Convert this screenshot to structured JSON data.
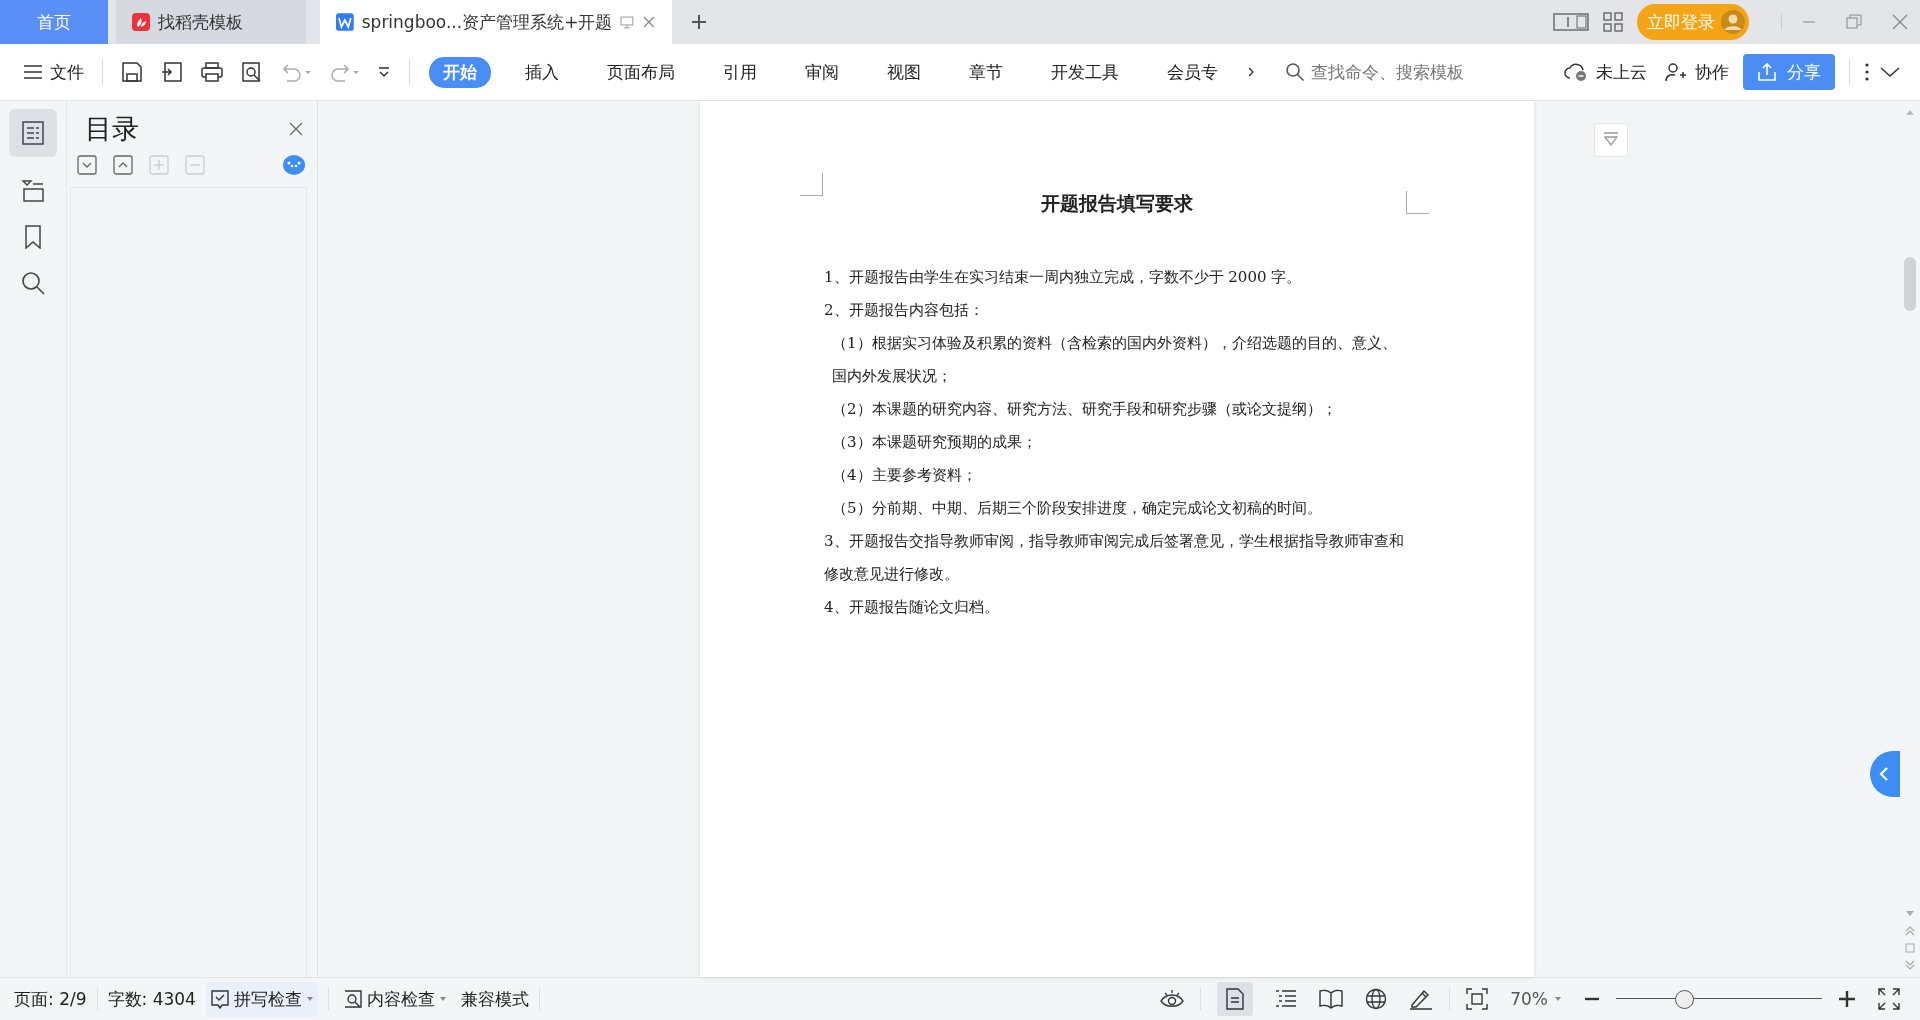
{
  "tabs": [
    {
      "kind": "home",
      "label": "首页",
      "selected": false
    },
    {
      "kind": "template",
      "label": "找稻壳模板",
      "selected": false
    },
    {
      "kind": "doc",
      "label": "springboo...资产管理系统+开题",
      "selected": true
    }
  ],
  "login_button": "立即登录",
  "toolbar": {
    "file_menu": "文件",
    "ribbon_tabs": [
      {
        "label": "开始",
        "selected": true
      },
      {
        "label": "插入",
        "selected": false
      },
      {
        "label": "页面布局",
        "selected": false
      },
      {
        "label": "引用",
        "selected": false
      },
      {
        "label": "审阅",
        "selected": false
      },
      {
        "label": "视图",
        "selected": false
      },
      {
        "label": "章节",
        "selected": false
      },
      {
        "label": "开发工具",
        "selected": false
      },
      {
        "label": "会员专",
        "selected": false
      }
    ],
    "search": {
      "placeholder": "查找命令、搜索模板"
    },
    "cloud_status": "未上云",
    "collab": "协作",
    "share": "分享"
  },
  "outline_panel": {
    "title": "目录"
  },
  "document": {
    "title": "开题报告填写要求",
    "paragraphs": [
      {
        "kind": "item",
        "text": "1、开题报告由学生在实习结束一周内独立完成，字数不少于 2000 字。"
      },
      {
        "kind": "item",
        "text": "2、开题报告内容包括："
      },
      {
        "kind": "sub",
        "text": "（1）根据实习体验及积累的资料（含检索的国内外资料），介绍选题的目的、意义、国内外发展状况；"
      },
      {
        "kind": "sub",
        "text": "（2）本课题的研究内容、研究方法、研究手段和研究步骤（或论文提纲）；"
      },
      {
        "kind": "sub",
        "text": "（3）本课题研究预期的成果；"
      },
      {
        "kind": "sub",
        "text": "（4）主要参考资料；"
      },
      {
        "kind": "sub",
        "text": "（5）分前期、中期、后期三个阶段安排进度，确定完成论文初稿的时间。"
      },
      {
        "kind": "item",
        "text": "3、开题报告交指导教师审阅，指导教师审阅完成后签署意见，学生根据指导教师审查和修改意见进行修改。"
      },
      {
        "kind": "item",
        "text": "4、开题报告随论文归档。"
      }
    ]
  },
  "status_bar": {
    "page": "页面: 2/9",
    "word_count": "字数: 4304",
    "spell_check": "拼写检查",
    "content_check": "内容检查",
    "mode": "兼容模式",
    "zoom": "70%",
    "zoom_slider": {
      "level": 0.33
    }
  }
}
